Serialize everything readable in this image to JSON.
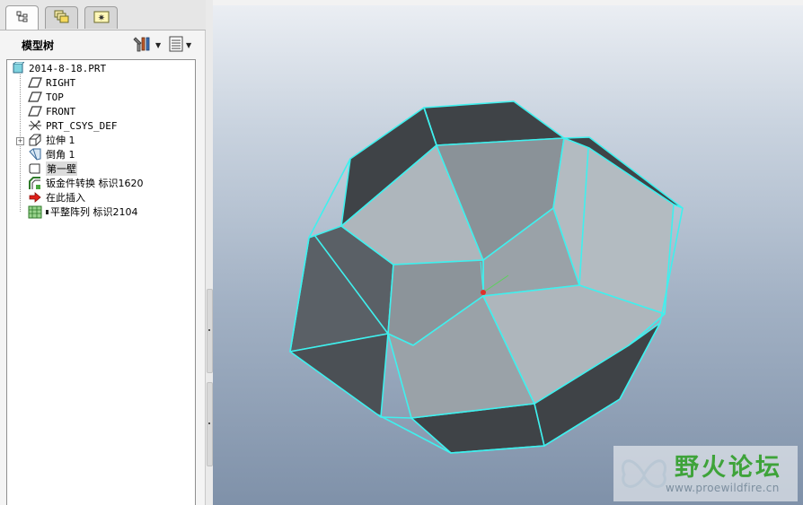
{
  "tabs": [
    {
      "name": "model-tree-tab",
      "icon": "model-tree-icon"
    },
    {
      "name": "layers-tab",
      "icon": "layers-icon"
    },
    {
      "name": "favorites-tab",
      "icon": "favorites-star-icon"
    }
  ],
  "tree_panel": {
    "title": "模型树",
    "settings_icon": "tree-settings-tools-icon",
    "show_icon": "tree-columns-icon"
  },
  "tree": {
    "root": "2014-8-18.PRT",
    "items": [
      {
        "label": "RIGHT",
        "icon": "datum-plane-icon"
      },
      {
        "label": "TOP",
        "icon": "datum-plane-icon"
      },
      {
        "label": "FRONT",
        "icon": "datum-plane-icon"
      },
      {
        "label": "PRT_CSYS_DEF",
        "icon": "coordinate-system-icon"
      },
      {
        "label": "拉伸 1",
        "icon": "extrude-icon"
      },
      {
        "label": "倒角 1",
        "icon": "chamfer-icon"
      },
      {
        "label": "第一壁",
        "icon": "first-wall-icon"
      },
      {
        "label": "钣金件转换 标识1620",
        "icon": "sheetmetal-convert-icon"
      },
      {
        "label": "在此插入",
        "icon": "insert-here-arrow-icon"
      },
      {
        "label": "平整阵列 标识2104",
        "icon": "flat-pattern-icon"
      }
    ]
  },
  "watermark": {
    "title": "野火论坛",
    "url": "www.proewildfire.cn"
  },
  "colors": {
    "edge": "#3ff0ee",
    "dark_face": "#3f4347",
    "light_face": "#aeb6bc",
    "mid_face": "#8a9298",
    "viewport_top": "#eceff4",
    "viewport_bottom": "#7f91a9"
  }
}
